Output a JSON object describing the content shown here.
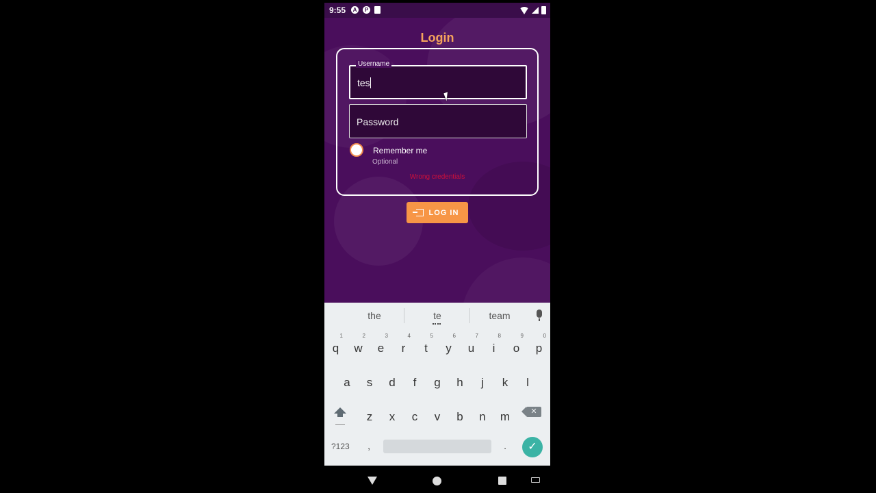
{
  "status_bar": {
    "time": "9:55",
    "icons": [
      "a-icon",
      "p-icon",
      "clipboard-icon"
    ],
    "right_icons": [
      "wifi-icon",
      "signal-icon",
      "battery-icon"
    ]
  },
  "app": {
    "title": "Login",
    "username": {
      "label": "Username",
      "value": "tes"
    },
    "password": {
      "placeholder": "Password"
    },
    "remember": {
      "label": "Remember me",
      "hint": "Optional"
    },
    "error": "Wrong credentials",
    "login_button": "LOG IN"
  },
  "keyboard": {
    "suggestions": [
      "the",
      "te",
      "team"
    ],
    "rows": [
      [
        {
          "k": "q",
          "h": "1"
        },
        {
          "k": "w",
          "h": "2"
        },
        {
          "k": "e",
          "h": "3"
        },
        {
          "k": "r",
          "h": "4"
        },
        {
          "k": "t",
          "h": "5"
        },
        {
          "k": "y",
          "h": "6"
        },
        {
          "k": "u",
          "h": "7"
        },
        {
          "k": "i",
          "h": "8"
        },
        {
          "k": "o",
          "h": "9"
        },
        {
          "k": "p",
          "h": "0"
        }
      ],
      [
        {
          "k": "a"
        },
        {
          "k": "s"
        },
        {
          "k": "d"
        },
        {
          "k": "f"
        },
        {
          "k": "g"
        },
        {
          "k": "h"
        },
        {
          "k": "j"
        },
        {
          "k": "k"
        },
        {
          "k": "l"
        }
      ],
      [
        {
          "k": "z"
        },
        {
          "k": "x"
        },
        {
          "k": "c"
        },
        {
          "k": "v"
        },
        {
          "k": "b"
        },
        {
          "k": "n"
        },
        {
          "k": "m"
        }
      ]
    ],
    "symbols_label": "?123",
    "comma": ",",
    "period": ".",
    "backspace_symbol": "✕",
    "enter_symbol": "✓"
  },
  "colors": {
    "background": "#4a0e5c",
    "accent": "#f79646",
    "title": "#f5a35c",
    "error": "#d0103a",
    "enter": "#3bb3a5"
  }
}
